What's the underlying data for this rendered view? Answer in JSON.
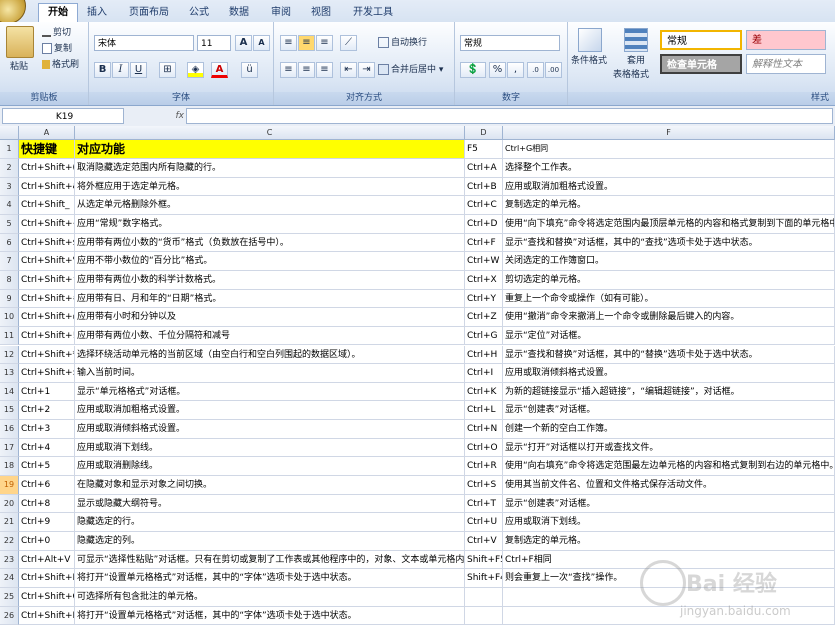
{
  "tabs": [
    "开始",
    "插入",
    "页面布局",
    "公式",
    "数据",
    "审阅",
    "视图",
    "开发工具"
  ],
  "clipboard": {
    "paste": "粘贴",
    "cut": "剪切",
    "copy": "复制",
    "format_painter": "格式刷",
    "label": "剪贴板"
  },
  "font": {
    "name": "宋体",
    "size": "11",
    "label": "字体",
    "bold": "B",
    "italic": "I",
    "underline": "U",
    "grow": "A",
    "shrink": "A"
  },
  "alignment": {
    "wrap": "自动换行",
    "merge": "合并后居中",
    "label": "对齐方式"
  },
  "number": {
    "format": "常规",
    "percent": "%",
    "comma": ",",
    "label": "数字",
    "inc": ".0",
    "dec": ".00"
  },
  "styles": {
    "conditional": "条件格式",
    "table": "套用",
    "table2": "表格格式",
    "normal": "常规",
    "bad": "差",
    "check": "检查单元格",
    "explanatory": "解释性文本",
    "label": "样式"
  },
  "formula_bar": {
    "cell_ref": "K19",
    "fx": "fx",
    "value": ""
  },
  "columns": [
    "A",
    "C",
    "D",
    "F"
  ],
  "header": {
    "a": "快捷键",
    "c": "对应功能",
    "d": "F5",
    "f": "Ctrl+G相同"
  },
  "rows": [
    {
      "n": "2",
      "a": "Ctrl+Shift+(",
      "c": "取消隐藏选定范围内所有隐藏的行。",
      "d": "Ctrl+A",
      "f": "选择整个工作表。"
    },
    {
      "n": "3",
      "a": "Ctrl+Shift+&",
      "c": "将外框应用于选定单元格。",
      "d": "Ctrl+B",
      "f": "应用或取消加粗格式设置。"
    },
    {
      "n": "4",
      "a": "Ctrl+Shift_",
      "c": "从选定单元格删除外框。",
      "d": "Ctrl+C",
      "f": "复制选定的单元格。"
    },
    {
      "n": "5",
      "a": "Ctrl+Shift+~",
      "c": "应用“常规”数字格式。",
      "d": "Ctrl+D",
      "f": "使用“向下填充”命令将选定范围内最顶层单元格的内容和格式复制到下面的单元格中。"
    },
    {
      "n": "6",
      "a": "Ctrl+Shift+$",
      "c": "应用带有两位小数的“货币”格式（负数放在括号中）。",
      "d": "Ctrl+F",
      "f": "显示“查找和替换”对话框，其中的“查找”选项卡处于选中状态。"
    },
    {
      "n": "7",
      "a": "Ctrl+Shift+%",
      "c": "应用不带小数位的“百分比”格式。",
      "d": "Ctrl+W",
      "f": "关闭选定的工作簿窗口。"
    },
    {
      "n": "8",
      "a": "Ctrl+Shift+^",
      "c": "应用带有两位小数的科学计数格式。",
      "d": "Ctrl+X",
      "f": "剪切选定的单元格。"
    },
    {
      "n": "9",
      "a": "Ctrl+Shift+#",
      "c": "应用带有日、月和年的“日期”格式。",
      "d": "Ctrl+Y",
      "f": "重复上一个命令或操作（如有可能）。"
    },
    {
      "n": "10",
      "a": "Ctrl+Shift+@",
      "c": "应用带有小时和分钟以及",
      "d": "Ctrl+Z",
      "f": "使用“撤消”命令来撤消上一个命令或删除最后键入的内容。"
    },
    {
      "n": "11",
      "a": "Ctrl+Shift+!",
      "c": "应用带有两位小数、千位分隔符和减号",
      "d": "Ctrl+G",
      "f": "显示“定位”对话框。"
    },
    {
      "n": "12",
      "a": "Ctrl+Shift+*",
      "c": "选择环绕活动单元格的当前区域（由空白行和空白列围起的数据区域）。",
      "d": "Ctrl+H",
      "f": "显示“查找和替换”对话框，其中的“替换”选项卡处于选中状态。"
    },
    {
      "n": "13",
      "a": "Ctrl+Shift+:",
      "c": "输入当前时间。",
      "d": "Ctrl+I",
      "f": "应用或取消倾斜格式设置。"
    },
    {
      "n": "14",
      "a": "Ctrl+1",
      "c": "显示“单元格格式”对话框。",
      "d": "Ctrl+K",
      "f": "为新的超链接显示“插入超链接”，“编辑超链接”，对话框。"
    },
    {
      "n": "15",
      "a": "Ctrl+2",
      "c": "应用或取消加粗格式设置。",
      "d": "Ctrl+L",
      "f": "显示“创建表”对话框。"
    },
    {
      "n": "16",
      "a": "Ctrl+3",
      "c": "应用或取消倾斜格式设置。",
      "d": "Ctrl+N",
      "f": "创建一个新的空白工作簿。"
    },
    {
      "n": "17",
      "a": "Ctrl+4",
      "c": "应用或取消下划线。",
      "d": "Ctrl+O",
      "f": "显示“打开”对话框以打开或查找文件。"
    },
    {
      "n": "18",
      "a": "Ctrl+5",
      "c": "应用或取消删除线。",
      "d": "Ctrl+R",
      "f": "使用“向右填充”命令将选定范围最左边单元格的内容和格式复制到右边的单元格中。"
    },
    {
      "n": "19",
      "a": "Ctrl+6",
      "c": "在隐藏对象和显示对象之间切换。",
      "d": "Ctrl+S",
      "f": "使用其当前文件名、位置和文件格式保存活动文件。"
    },
    {
      "n": "20",
      "a": "Ctrl+8",
      "c": "显示或隐藏大纲符号。",
      "d": "Ctrl+T",
      "f": "显示“创建表”对话框。"
    },
    {
      "n": "21",
      "a": "Ctrl+9",
      "c": "隐藏选定的行。",
      "d": "Ctrl+U",
      "f": "应用或取消下划线。"
    },
    {
      "n": "22",
      "a": "Ctrl+0",
      "c": "隐藏选定的列。",
      "d": "Ctrl+V",
      "f": "复制选定的单元格。"
    },
    {
      "n": "23",
      "a": "Ctrl+Alt+V",
      "c": "可显示“选择性粘贴”对话框。只有在剪切或复制了工作表或其他程序中的，对象、文本或单元格内容",
      "d": "Shift+F5",
      "f": "Ctrl+F相同"
    },
    {
      "n": "24",
      "a": "Ctrl+Shift+F",
      "c": "将打开“设置单元格格式”对话框，其中的“字体”选项卡处于选中状态。",
      "d": "Shift+F4",
      "f": "则会重复上一次“查找”操作。"
    },
    {
      "n": "25",
      "a": "Ctrl+Shift+O",
      "c": "可选择所有包含批注的单元格。",
      "d": "",
      "f": ""
    },
    {
      "n": "26",
      "a": "Ctrl+Shift+P",
      "c": "将打开“设置单元格格式”对话框，其中的“字体”选项卡处于选中状态。",
      "d": "",
      "f": ""
    }
  ],
  "watermark": "jingyan.baidu.com"
}
